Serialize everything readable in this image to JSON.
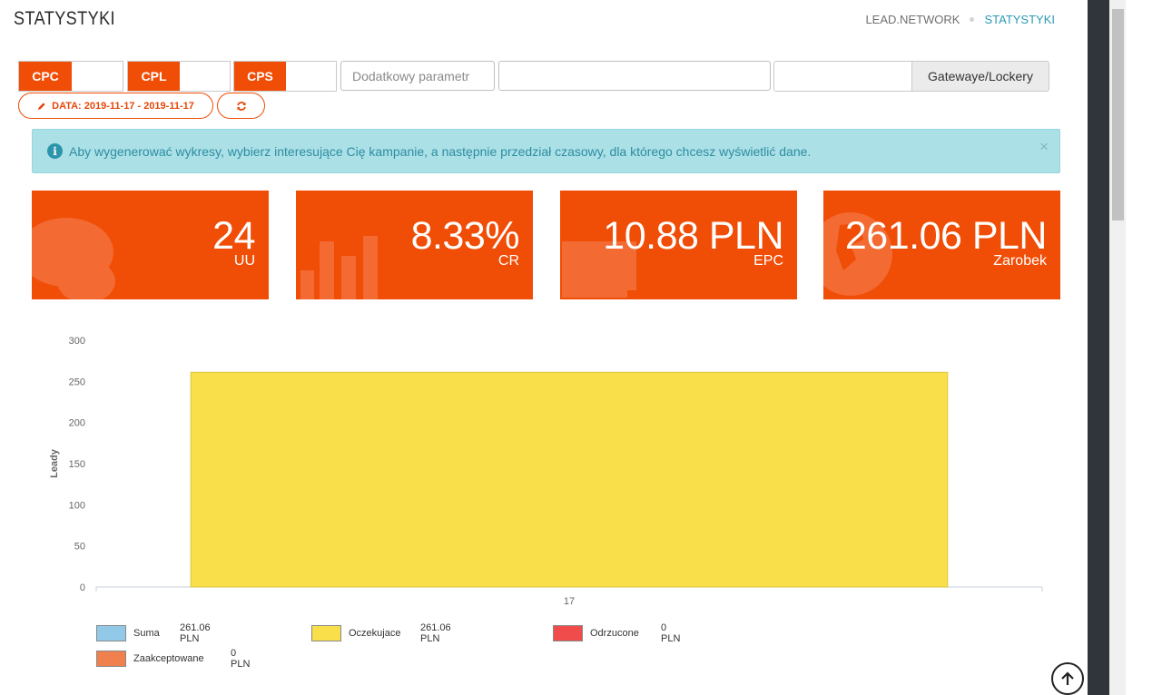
{
  "header": {
    "title": "STATYSTYKI",
    "breadcrumb": [
      "LEAD.NETWORK",
      "STATYSTYKI"
    ]
  },
  "filters": {
    "segments": [
      "CPC",
      "CPL",
      "CPS"
    ],
    "extra_param_placeholder": "Dodatkowy parametr",
    "search_value": "",
    "gateway_button": "Gatewaye/Lockery",
    "date_button": "DATA: 2019-11-17 - 2019-11-17"
  },
  "alert": {
    "text": "Aby wygenerować wykresy, wybierz interesujące Cię kampanie, a następnie przedział czasowy, dla którego chcesz wyświetlić dane.",
    "close": "×"
  },
  "stats": [
    {
      "value": "24",
      "label": "UU"
    },
    {
      "value": "8.33%",
      "label": "CR"
    },
    {
      "value": "10.88 PLN",
      "label": "EPC"
    },
    {
      "value": "261.06 PLN",
      "label": "Zarobek"
    }
  ],
  "chart_data": {
    "type": "bar",
    "categories": [
      "17"
    ],
    "series": [
      {
        "name": "Oczekujace",
        "values": [
          261.06
        ],
        "color": "#f9df4a"
      }
    ],
    "ylabel": "Leady",
    "xlabel": "",
    "ylim": [
      0,
      300
    ],
    "yticks": [
      0,
      50,
      100,
      150,
      200,
      250,
      300
    ],
    "grid": false
  },
  "legend": [
    {
      "name": "Suma",
      "amount": "261.06 PLN",
      "color": "#92c9e8"
    },
    {
      "name": "Oczekujace",
      "amount": "261.06 PLN",
      "color": "#f9df4a"
    },
    {
      "name": "Odrzucone",
      "amount": "0 PLN",
      "color": "#f04c4c"
    },
    {
      "name": "Zaakceptowane",
      "amount": "0 PLN",
      "color": "#f0804e"
    }
  ],
  "colors": {
    "accent": "#f04d06",
    "alert_bg": "#abe0e6",
    "link": "#2a9ab4"
  },
  "icons": {
    "pencil": "pencil-icon",
    "refresh": "refresh-icon",
    "info": "info-icon",
    "to_top": "arrow-up-circle-icon"
  }
}
